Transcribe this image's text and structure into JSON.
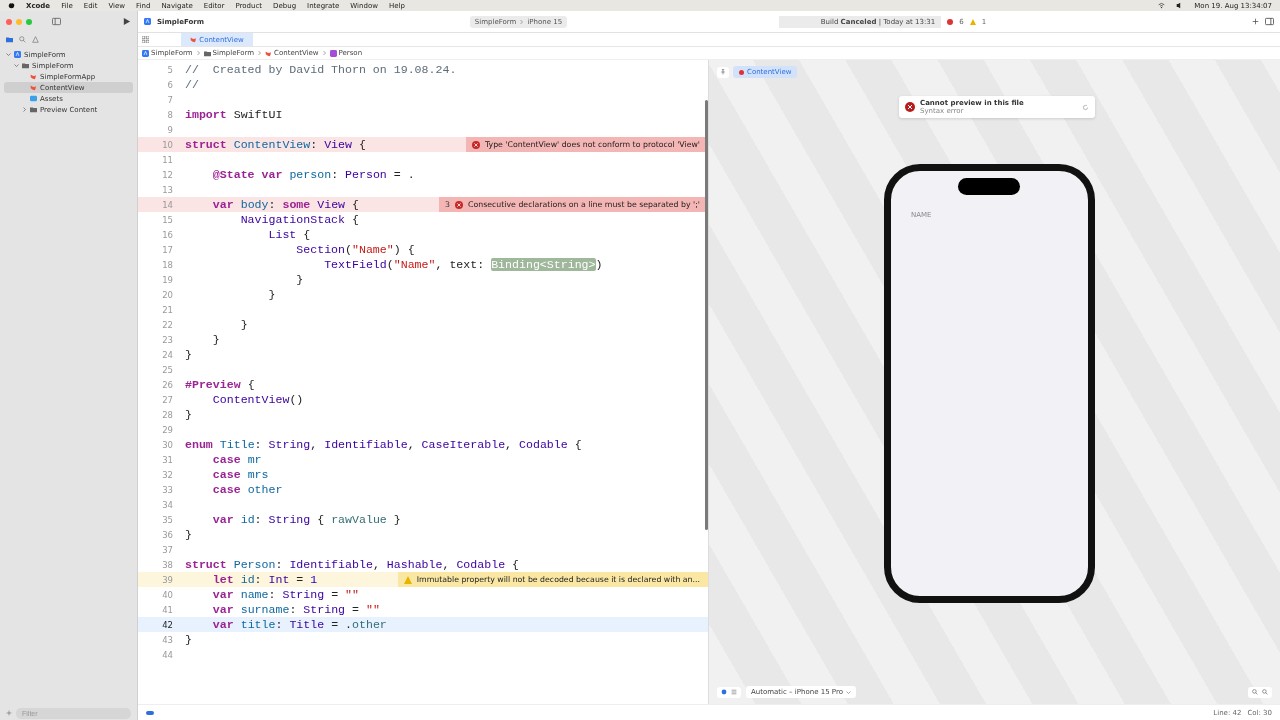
{
  "menu_bar": {
    "app": "Xcode",
    "menus": [
      "File",
      "Edit",
      "View",
      "Find",
      "Navigate",
      "Editor",
      "Product",
      "Debug",
      "Integrate",
      "Window",
      "Help"
    ],
    "clock": "Mon 19. Aug  13:34:07"
  },
  "toolbar": {
    "title": "SimpleForm",
    "scheme": "SimpleForm",
    "destination": "iPhone 15",
    "status": "Build **Canceled** | Today at 13:31",
    "errors": "6",
    "warnings": "1"
  },
  "navigator": {
    "tree": [
      {
        "label": "SimpleForm",
        "kind": "project",
        "expanded": true,
        "selected": false,
        "children": [
          {
            "label": "SimpleForm",
            "kind": "folder",
            "expanded": true,
            "selected": false,
            "children": [
              {
                "label": "SimpleFormApp",
                "kind": "swift",
                "selected": false
              },
              {
                "label": "ContentView",
                "kind": "swift",
                "selected": true
              },
              {
                "label": "Assets",
                "kind": "assets",
                "selected": false
              },
              {
                "label": "Preview Content",
                "kind": "folder",
                "expanded": false,
                "selected": false
              }
            ]
          }
        ]
      }
    ],
    "filter": {
      "placeholder": "Filter"
    }
  },
  "tabs": [
    {
      "label": "ContentView",
      "selected": true
    }
  ],
  "breadcrumb": [
    {
      "label": "SimpleForm",
      "kind": "project"
    },
    {
      "label": "SimpleForm",
      "kind": "folder"
    },
    {
      "label": "ContentView",
      "kind": "swift"
    },
    {
      "label": "Person",
      "kind": "struct"
    }
  ],
  "code": [
    {
      "no": "5",
      "current": false,
      "tokens": [
        {
          "kind": "c",
          "text": "//  Created by David Thorn on 19.08.24."
        }
      ]
    },
    {
      "no": "6",
      "current": false,
      "tokens": [
        {
          "kind": "c",
          "text": "//"
        }
      ]
    },
    {
      "no": "7",
      "current": false
    },
    {
      "no": "8",
      "current": false,
      "tokens": [
        {
          "kind": "k",
          "text": "import"
        },
        {
          "kind": "p",
          "text": " SwiftUI"
        }
      ]
    },
    {
      "no": "9",
      "current": false
    },
    {
      "no": "10",
      "current": false,
      "tokens": [
        {
          "kind": "k",
          "text": "struct "
        },
        {
          "kind": "d",
          "text": "ContentView"
        },
        {
          "kind": "p",
          "text": ": "
        },
        {
          "kind": "t",
          "text": "View"
        },
        {
          "kind": "p",
          "text": " {"
        }
      ],
      "issue": {
        "kind": "error",
        "text": "Type 'ContentView' does not conform to protocol 'View'"
      }
    },
    {
      "no": "11",
      "current": false
    },
    {
      "no": "12",
      "current": false,
      "tokens": [
        {
          "kind": "k",
          "text": "    @State var "
        },
        {
          "kind": "d",
          "text": "person"
        },
        {
          "kind": "p",
          "text": ": "
        },
        {
          "kind": "t",
          "text": "Person"
        },
        {
          "kind": "p",
          "text": " = ."
        }
      ]
    },
    {
      "no": "13",
      "current": false
    },
    {
      "no": "14",
      "current": false,
      "tokens": [
        {
          "kind": "k",
          "text": "    var "
        },
        {
          "kind": "d",
          "text": "body"
        },
        {
          "kind": "p",
          "text": ": "
        },
        {
          "kind": "k",
          "text": "some "
        },
        {
          "kind": "t",
          "text": "View"
        },
        {
          "kind": "p",
          "text": " {"
        }
      ],
      "issue": {
        "kind": "error",
        "count": "3",
        "text": "Consecutive declarations on a line must be separated by ';'"
      }
    },
    {
      "no": "15",
      "current": false,
      "tokens": [
        {
          "kind": "t",
          "text": "        NavigationStack"
        },
        {
          "kind": "p",
          "text": " {"
        }
      ]
    },
    {
      "no": "16",
      "current": false,
      "tokens": [
        {
          "kind": "t",
          "text": "            List"
        },
        {
          "kind": "p",
          "text": " {"
        }
      ]
    },
    {
      "no": "17",
      "current": false,
      "tokens": [
        {
          "kind": "t",
          "text": "                Section"
        },
        {
          "kind": "p",
          "text": "("
        },
        {
          "kind": "s",
          "text": "\"Name\""
        },
        {
          "kind": "p",
          "text": ") {"
        }
      ]
    },
    {
      "no": "18",
      "current": false,
      "tokens": [
        {
          "kind": "t",
          "text": "                    TextField"
        },
        {
          "kind": "p",
          "text": "("
        },
        {
          "kind": "s",
          "text": "\"Name\""
        },
        {
          "kind": "p",
          "text": ", text: "
        },
        {
          "kind": "ph",
          "text": "Binding<String>"
        },
        {
          "kind": "p",
          "text": ")"
        }
      ]
    },
    {
      "no": "19",
      "current": false,
      "tokens": [
        {
          "kind": "p",
          "text": "                }"
        }
      ]
    },
    {
      "no": "20",
      "current": false,
      "tokens": [
        {
          "kind": "p",
          "text": "            }"
        }
      ]
    },
    {
      "no": "21",
      "current": false
    },
    {
      "no": "22",
      "current": false,
      "tokens": [
        {
          "kind": "p",
          "text": "        }"
        }
      ]
    },
    {
      "no": "23",
      "current": false,
      "tokens": [
        {
          "kind": "p",
          "text": "    }"
        }
      ]
    },
    {
      "no": "24",
      "current": false,
      "tokens": [
        {
          "kind": "p",
          "text": "}"
        }
      ]
    },
    {
      "no": "25",
      "current": false
    },
    {
      "no": "26",
      "current": false,
      "tokens": [
        {
          "kind": "k",
          "text": "#Preview"
        },
        {
          "kind": "p",
          "text": " {"
        }
      ]
    },
    {
      "no": "27",
      "current": false,
      "tokens": [
        {
          "kind": "t",
          "text": "    ContentView"
        },
        {
          "kind": "p",
          "text": "()"
        }
      ]
    },
    {
      "no": "28",
      "current": false,
      "tokens": [
        {
          "kind": "p",
          "text": "}"
        }
      ]
    },
    {
      "no": "29",
      "current": false
    },
    {
      "no": "30",
      "current": false,
      "tokens": [
        {
          "kind": "k",
          "text": "enum "
        },
        {
          "kind": "d",
          "text": "Title"
        },
        {
          "kind": "p",
          "text": ": "
        },
        {
          "kind": "t",
          "text": "String"
        },
        {
          "kind": "p",
          "text": ", "
        },
        {
          "kind": "t",
          "text": "Identifiable"
        },
        {
          "kind": "p",
          "text": ", "
        },
        {
          "kind": "t",
          "text": "CaseIterable"
        },
        {
          "kind": "p",
          "text": ", "
        },
        {
          "kind": "t",
          "text": "Codable"
        },
        {
          "kind": "p",
          "text": " {"
        }
      ]
    },
    {
      "no": "31",
      "current": false,
      "tokens": [
        {
          "kind": "k",
          "text": "    case "
        },
        {
          "kind": "d",
          "text": "mr"
        }
      ]
    },
    {
      "no": "32",
      "current": false,
      "tokens": [
        {
          "kind": "k",
          "text": "    case "
        },
        {
          "kind": "d",
          "text": "mrs"
        }
      ]
    },
    {
      "no": "33",
      "current": false,
      "tokens": [
        {
          "kind": "k",
          "text": "    case "
        },
        {
          "kind": "d",
          "text": "other"
        }
      ]
    },
    {
      "no": "34",
      "current": false
    },
    {
      "no": "35",
      "current": false,
      "tokens": [
        {
          "kind": "k",
          "text": "    var "
        },
        {
          "kind": "d",
          "text": "id"
        },
        {
          "kind": "p",
          "text": ": "
        },
        {
          "kind": "t",
          "text": "String"
        },
        {
          "kind": "p",
          "text": " { "
        },
        {
          "kind": "m",
          "text": "rawValue"
        },
        {
          "kind": "p",
          "text": " }"
        }
      ]
    },
    {
      "no": "36",
      "current": false,
      "tokens": [
        {
          "kind": "p",
          "text": "}"
        }
      ]
    },
    {
      "no": "37",
      "current": false
    },
    {
      "no": "38",
      "current": false,
      "tokens": [
        {
          "kind": "k",
          "text": "struct "
        },
        {
          "kind": "d",
          "text": "Person"
        },
        {
          "kind": "p",
          "text": ": "
        },
        {
          "kind": "t",
          "text": "Identifiable"
        },
        {
          "kind": "p",
          "text": ", "
        },
        {
          "kind": "t",
          "text": "Hashable"
        },
        {
          "kind": "p",
          "text": ", "
        },
        {
          "kind": "t",
          "text": "Codable"
        },
        {
          "kind": "p",
          "text": " {"
        }
      ]
    },
    {
      "no": "39",
      "current": false,
      "tokens": [
        {
          "kind": "k",
          "text": "    let "
        },
        {
          "kind": "d",
          "text": "id"
        },
        {
          "kind": "p",
          "text": ": "
        },
        {
          "kind": "t",
          "text": "Int"
        },
        {
          "kind": "p",
          "text": " = "
        },
        {
          "kind": "n",
          "text": "1"
        }
      ],
      "issue": {
        "kind": "warning",
        "text": "Immutable property will not be decoded because it is declared with an..."
      }
    },
    {
      "no": "40",
      "current": false,
      "tokens": [
        {
          "kind": "k",
          "text": "    var "
        },
        {
          "kind": "d",
          "text": "name"
        },
        {
          "kind": "p",
          "text": ": "
        },
        {
          "kind": "t",
          "text": "String"
        },
        {
          "kind": "p",
          "text": " = "
        },
        {
          "kind": "s",
          "text": "\"\""
        }
      ]
    },
    {
      "no": "41",
      "current": false,
      "tokens": [
        {
          "kind": "k",
          "text": "    var "
        },
        {
          "kind": "d",
          "text": "surname"
        },
        {
          "kind": "p",
          "text": ": "
        },
        {
          "kind": "t",
          "text": "String"
        },
        {
          "kind": "p",
          "text": " = "
        },
        {
          "kind": "s",
          "text": "\"\""
        }
      ]
    },
    {
      "no": "42",
      "current": true,
      "tokens": [
        {
          "kind": "k",
          "text": "    var "
        },
        {
          "kind": "d",
          "text": "title"
        },
        {
          "kind": "p",
          "text": ": "
        },
        {
          "kind": "t",
          "text": "Title"
        },
        {
          "kind": "p",
          "text": " = ."
        },
        {
          "kind": "m",
          "text": "other"
        }
      ]
    },
    {
      "no": "43",
      "current": false,
      "tokens": [
        {
          "kind": "p",
          "text": "}"
        }
      ]
    },
    {
      "no": "44",
      "current": false
    }
  ],
  "preview": {
    "chip": "ContentView",
    "error_title": "Cannot preview in this file",
    "error_detail": "Syntax error",
    "section_header": "NAME",
    "device": "Automatic – iPhone 15 Pro"
  },
  "status_bar": {
    "line": "Line: 42",
    "col": "Col: 30"
  }
}
